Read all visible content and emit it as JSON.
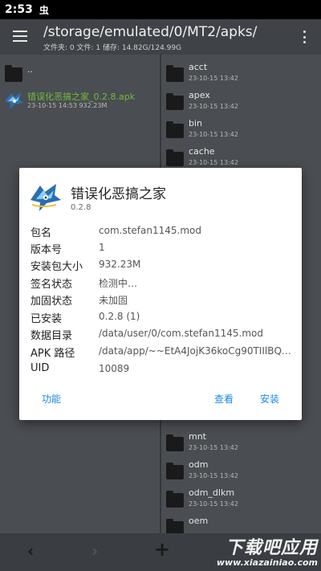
{
  "status_bar": {
    "time": "2:53",
    "debug_glyph": "虫"
  },
  "app_bar": {
    "path": "/storage/emulated/0/MT2/apks/",
    "subtitle": "文件夹: 0  文件: 1  储存: 14.82G/124.99G"
  },
  "left_panel": {
    "parent_dir": "..",
    "apk_file": {
      "name": "错误化恶搞之家_0.2.8.apk",
      "meta": "23-10-15 14:53  932.23M"
    }
  },
  "right_panel": {
    "folders": [
      {
        "name": "acct",
        "date": "23-10-15 13:42"
      },
      {
        "name": "apex",
        "date": "23-10-15 13:42"
      },
      {
        "name": "bin",
        "date": "23-10-15 13:42"
      },
      {
        "name": "cache",
        "date": "23-10-15 13:42"
      },
      {
        "name": "mnt",
        "date": "23-10-15 13:42"
      },
      {
        "name": "odm",
        "date": "23-10-15 13:42"
      },
      {
        "name": "odm_dlkm",
        "date": "23-10-15 13:42"
      },
      {
        "name": "oem",
        "date": ""
      }
    ]
  },
  "dialog": {
    "title": "错误化恶搞之家",
    "version": "0.2.8",
    "rows": [
      {
        "label": "包名",
        "value": "com.stefan1145.mod"
      },
      {
        "label": "版本号",
        "value": "1"
      },
      {
        "label": "安装包大小",
        "value": "932.23M"
      },
      {
        "label": "签名状态",
        "value": "检测中…"
      },
      {
        "label": "加固状态",
        "value": "未加固"
      },
      {
        "label": "已安装",
        "value": "0.2.8 (1)"
      },
      {
        "label": "数据目录",
        "value": "/data/user/0/com.stefan1145.mod"
      },
      {
        "label": "APK 路径",
        "value": "/data/app/~~EtA4JojK36koCg90TIIlBQ==/c..."
      },
      {
        "label": "UID",
        "value": "10089"
      }
    ],
    "buttons": {
      "function": "功能",
      "view": "查看",
      "install": "安装"
    }
  },
  "bottom_bar": {
    "back": "‹",
    "forward": "›",
    "add": "+"
  },
  "watermark": {
    "main": "下载吧应用",
    "sub": "www.xiazainiao.com"
  },
  "colors": {
    "accent": "#1e88e5",
    "apk_text": "#6dbd3b",
    "panel_bg": "#4a4d51",
    "app_bar": "#3f4347"
  }
}
